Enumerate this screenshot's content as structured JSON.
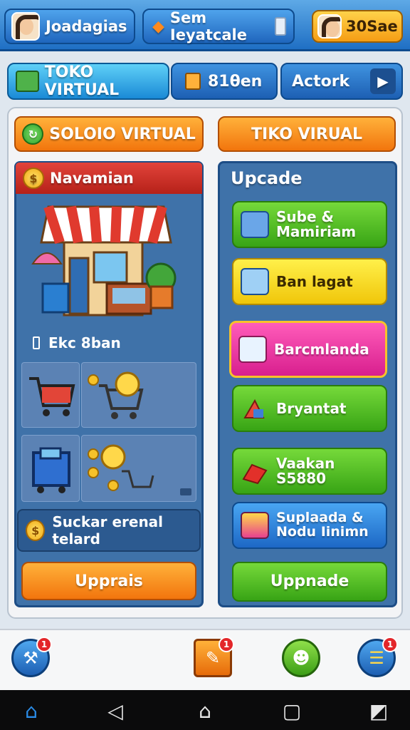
{
  "topbar": {
    "left_title": "Joadagias",
    "center_title": "Sem Ieyatcale",
    "currency": "30Sae"
  },
  "tabs": [
    {
      "label": "TOKO VIRTUAL"
    },
    {
      "label": "81θen"
    },
    {
      "label": "Actork"
    }
  ],
  "headers": {
    "left_button": "SOLOIO VIRTUAL",
    "right_button": "TIKO VIRUAL"
  },
  "left_panel": {
    "title": "Navamian",
    "section_label": "Ekc 8ban",
    "footer_text": "Suckar erenal telard",
    "action_button": "Upprais"
  },
  "right_panel": {
    "title": "Upcade",
    "items": [
      {
        "label": "Sube & Mamiriam"
      },
      {
        "label": "Ban lagat"
      },
      {
        "label": "Barcmlanda"
      },
      {
        "label": "Bryantat"
      },
      {
        "label": "Vaakan S5880"
      },
      {
        "label": "Suplaada & Nodu Iinimn"
      }
    ],
    "action_button": "Uppnade"
  },
  "colors": {
    "accent_blue": "#1f6fc4",
    "accent_orange": "#f2750d",
    "accent_green": "#38a415",
    "badge_red": "#e3262a"
  },
  "bottom_nav": {
    "badges": [
      "1",
      "1",
      "1"
    ]
  }
}
